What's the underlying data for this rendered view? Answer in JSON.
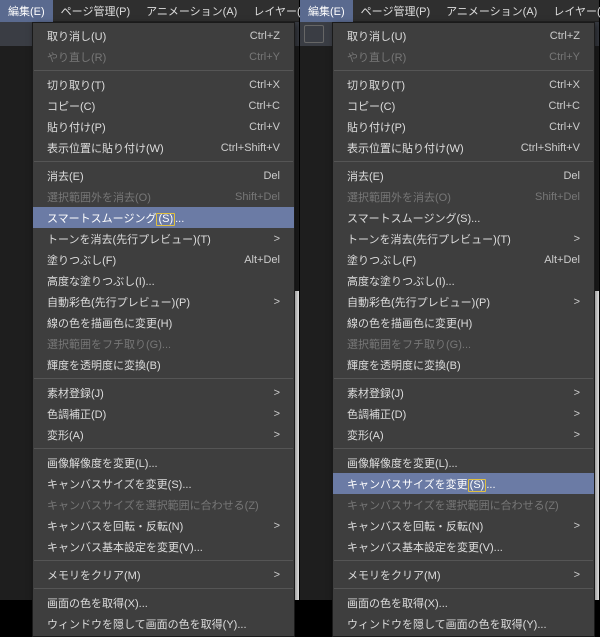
{
  "menubar": {
    "edit": "編集(E)",
    "page": "ページ管理(P)",
    "anim": "アニメーション(A)",
    "layer": "レイヤー(L)"
  },
  "menu": {
    "undo": {
      "label": "取り消し(U)",
      "shortcut": "Ctrl+Z"
    },
    "redo": {
      "label": "やり直し(R)",
      "shortcut": "Ctrl+Y"
    },
    "cut": {
      "label": "切り取り(T)",
      "shortcut": "Ctrl+X"
    },
    "copy": {
      "label": "コピー(C)",
      "shortcut": "Ctrl+C"
    },
    "paste": {
      "label": "貼り付け(P)",
      "shortcut": "Ctrl+V"
    },
    "pasteAt": {
      "label": "表示位置に貼り付け(W)",
      "shortcut": "Ctrl+Shift+V"
    },
    "erase": {
      "label": "消去(E)",
      "shortcut": "Del"
    },
    "eraseOutside": {
      "label": "選択範囲外を消去(O)",
      "shortcut": "Shift+Del"
    },
    "smartSmoothing_pre": "スマートスムージング",
    "smartSmoothing_hot": "(S)",
    "smartSmoothing_post": "...",
    "removeTones": {
      "label": "トーンを消去(先行プレビュー)(T)"
    },
    "fill": {
      "label": "塗りつぶし(F)",
      "shortcut": "Alt+Del"
    },
    "advFill": {
      "label": "高度な塗りつぶし(I)..."
    },
    "autoColor": {
      "label": "自動彩色(先行プレビュー)(P)"
    },
    "lineToDraw": {
      "label": "線の色を描画色に変更(H)"
    },
    "selOutline": {
      "label": "選択範囲をフチ取り(G)..."
    },
    "lumToAlpha": {
      "label": "輝度を透明度に変換(B)"
    },
    "matReg": {
      "label": "素材登録(J)"
    },
    "tonal": {
      "label": "色調補正(D)"
    },
    "transform": {
      "label": "変形(A)"
    },
    "changeRes": {
      "label": "画像解像度を変更(L)..."
    },
    "canvasSize_plain": "キャンバスサイズを変更(S)...",
    "canvasSize_pre": "キャンバスサイズを変更",
    "canvasSize_hot": "(S)",
    "canvasSize_post": "...",
    "fitCanvas": {
      "label": "キャンバスサイズを選択範囲に合わせる(Z)"
    },
    "rotateFlip": {
      "label": "キャンバスを回転・反転(N)"
    },
    "canvasSettings": {
      "label": "キャンバス基本設定を変更(V)..."
    },
    "clearMem": {
      "label": "メモリをクリア(M)"
    },
    "getScreenColor": {
      "label": "画面の色を取得(X)..."
    },
    "hideGetColor": {
      "label": "ウィンドウを隠して画面の色を取得(Y)..."
    }
  },
  "arrow": ">"
}
